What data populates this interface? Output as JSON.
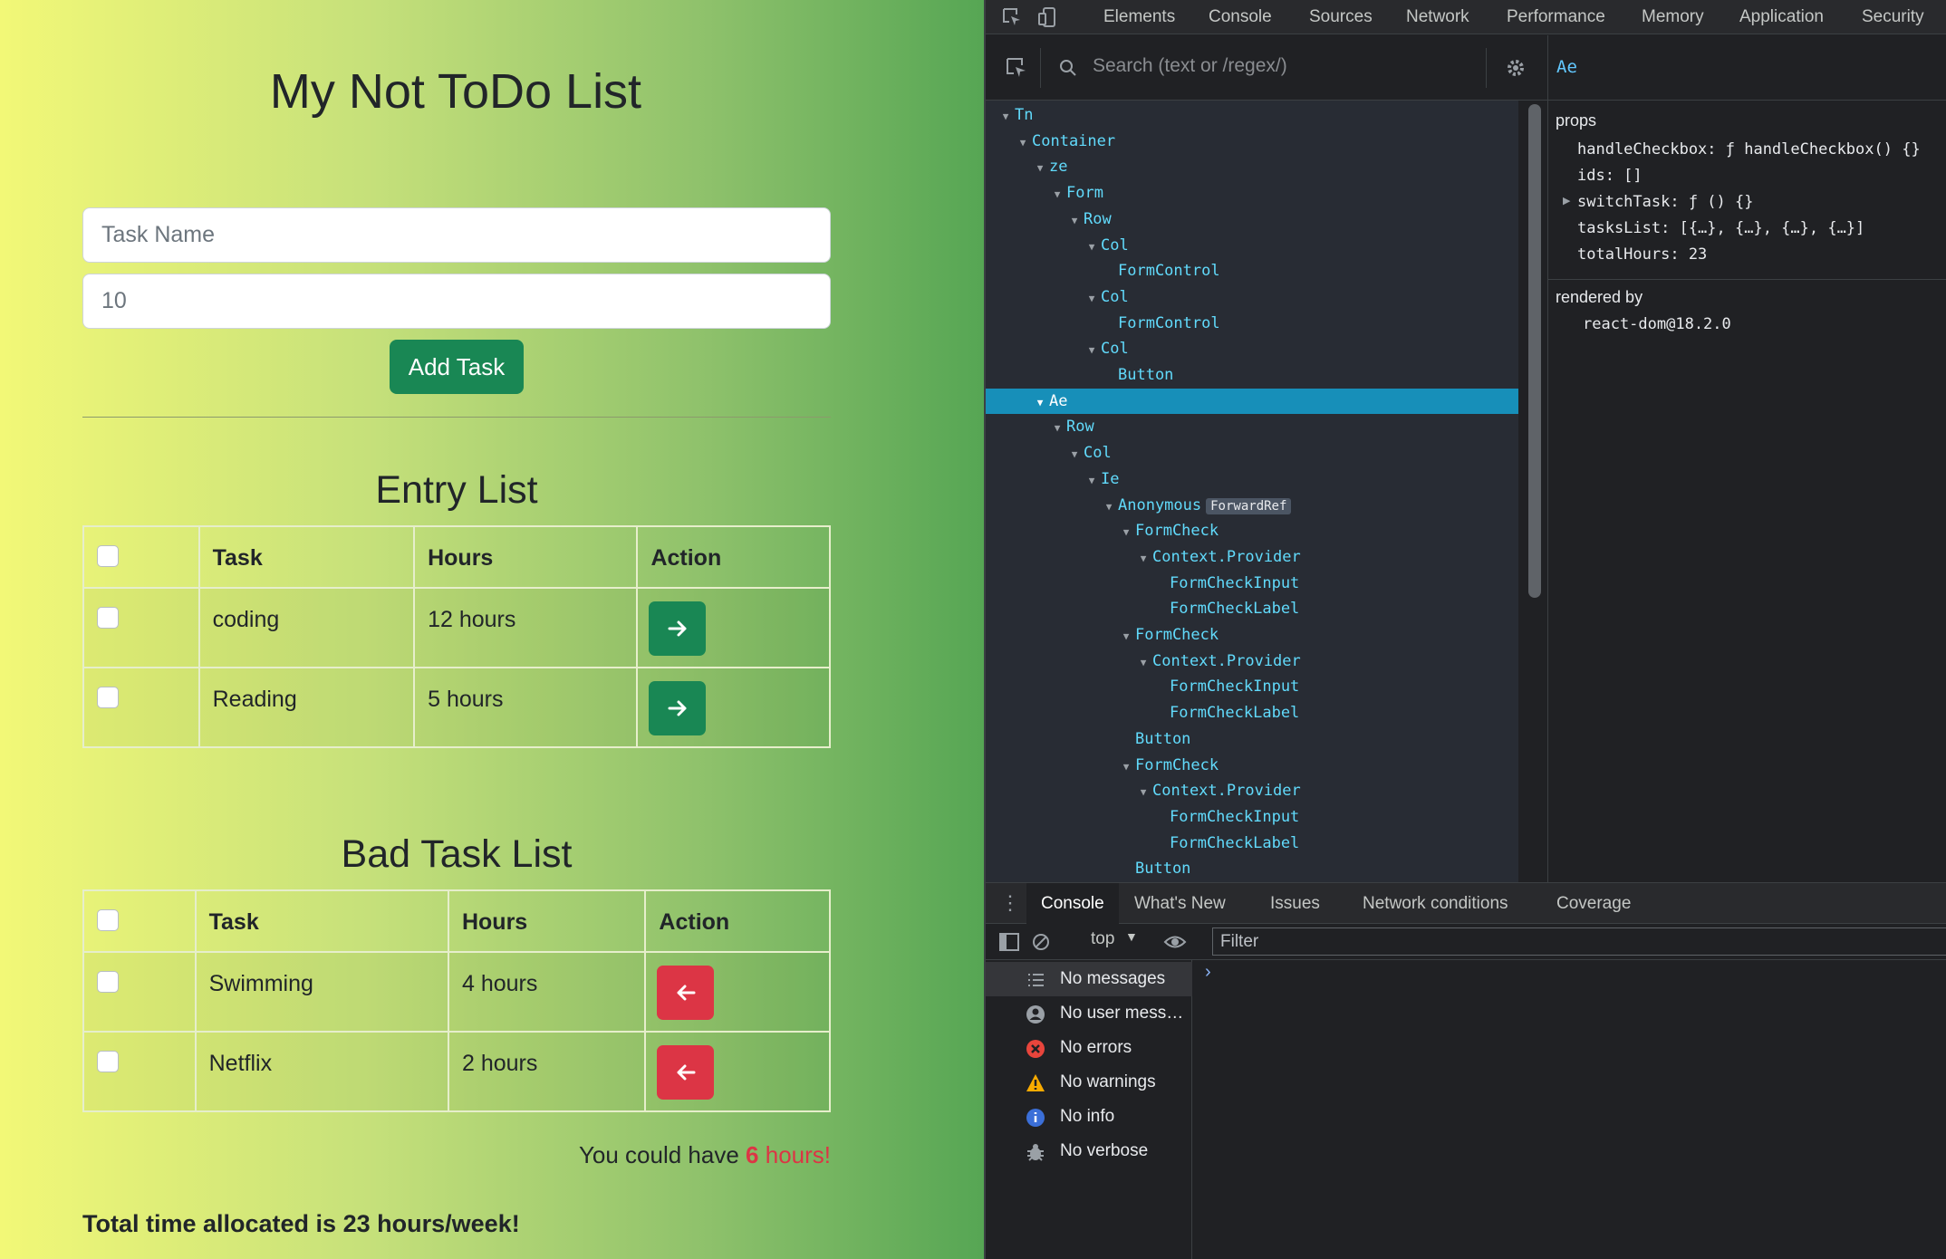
{
  "app": {
    "title": "My Not ToDo List",
    "task_name_placeholder": "Task Name",
    "hours_value": "10",
    "add_button": "Add Task",
    "entry_list": {
      "title": "Entry List",
      "headers": [
        "Task",
        "Hours",
        "Action"
      ],
      "rows": [
        {
          "task": "coding",
          "hours": "12 hours"
        },
        {
          "task": "Reading",
          "hours": "5 hours"
        }
      ]
    },
    "bad_list": {
      "title": "Bad Task List",
      "headers": [
        "Task",
        "Hours",
        "Action"
      ],
      "rows": [
        {
          "task": "Swimming",
          "hours": "4 hours"
        },
        {
          "task": "Netflix",
          "hours": "2 hours"
        }
      ]
    },
    "saved": {
      "prefix": "You could have",
      "number": "6",
      "suffix": "hours!"
    },
    "total": {
      "prefix": "Total time allocated is",
      "number": "23",
      "suffix": "hours/week!"
    },
    "colors": {
      "primary": "#198754",
      "danger": "#dc3545"
    }
  },
  "devtools": {
    "tabs": [
      "Elements",
      "Console",
      "Sources",
      "Network",
      "Performance",
      "Memory",
      "Application",
      "Security"
    ],
    "search_placeholder": "Search (text or /regex/)",
    "selected_component": "Ae",
    "tree": [
      {
        "name": "Tn",
        "level": 0,
        "expanded": true
      },
      {
        "name": "Container",
        "level": 1,
        "expanded": true
      },
      {
        "name": "ze",
        "level": 2,
        "expanded": true
      },
      {
        "name": "Form",
        "level": 3,
        "expanded": true
      },
      {
        "name": "Row",
        "level": 4,
        "expanded": true
      },
      {
        "name": "Col",
        "level": 5,
        "expanded": true
      },
      {
        "name": "FormControl",
        "level": 6,
        "expanded": false
      },
      {
        "name": "Col",
        "level": 5,
        "expanded": true
      },
      {
        "name": "FormControl",
        "level": 6,
        "expanded": false
      },
      {
        "name": "Col",
        "level": 5,
        "expanded": true
      },
      {
        "name": "Button",
        "level": 6,
        "expanded": false
      },
      {
        "name": "Ae",
        "level": 2,
        "expanded": true,
        "selected": true
      },
      {
        "name": "Row",
        "level": 3,
        "expanded": true
      },
      {
        "name": "Col",
        "level": 4,
        "expanded": true
      },
      {
        "name": "Ie",
        "level": 5,
        "expanded": true
      },
      {
        "name": "Anonymous",
        "level": 6,
        "expanded": true,
        "badge": "ForwardRef"
      },
      {
        "name": "FormCheck",
        "level": 7,
        "expanded": true
      },
      {
        "name": "Context.Provider",
        "level": 8,
        "expanded": true
      },
      {
        "name": "FormCheckInput",
        "level": 9,
        "expanded": false
      },
      {
        "name": "FormCheckLabel",
        "level": 9,
        "expanded": false
      },
      {
        "name": "FormCheck",
        "level": 7,
        "expanded": true
      },
      {
        "name": "Context.Provider",
        "level": 8,
        "expanded": true
      },
      {
        "name": "FormCheckInput",
        "level": 9,
        "expanded": false
      },
      {
        "name": "FormCheckLabel",
        "level": 9,
        "expanded": false
      },
      {
        "name": "Button",
        "level": 7,
        "expanded": false
      },
      {
        "name": "FormCheck",
        "level": 7,
        "expanded": true
      },
      {
        "name": "Context.Provider",
        "level": 8,
        "expanded": true
      },
      {
        "name": "FormCheckInput",
        "level": 9,
        "expanded": false
      },
      {
        "name": "FormCheckLabel",
        "level": 9,
        "expanded": false
      },
      {
        "name": "Button",
        "level": 7,
        "expanded": false
      }
    ],
    "props_header": "props",
    "props": [
      "handleCheckbox: ƒ handleCheckbox() {}",
      "ids: []",
      "switchTask: ƒ () {}",
      "tasksList: [{…}, {…}, {…}, {…}]",
      "totalHours: 23"
    ],
    "rendered_by_label": "rendered by",
    "rendered_by": "react-dom@18.2.0",
    "console_tabs": [
      "Console",
      "What's New",
      "Issues",
      "Network conditions",
      "Coverage"
    ],
    "context": "top",
    "filter_placeholder": "Filter",
    "console_side": [
      {
        "label": "No messages",
        "icon": "list-icon"
      },
      {
        "label": "No user mess…",
        "icon": "user-icon"
      },
      {
        "label": "No errors",
        "icon": "error-icon"
      },
      {
        "label": "No warnings",
        "icon": "warning-icon"
      },
      {
        "label": "No info",
        "icon": "info-icon"
      },
      {
        "label": "No verbose",
        "icon": "bug-icon"
      }
    ],
    "prompt": "›"
  }
}
